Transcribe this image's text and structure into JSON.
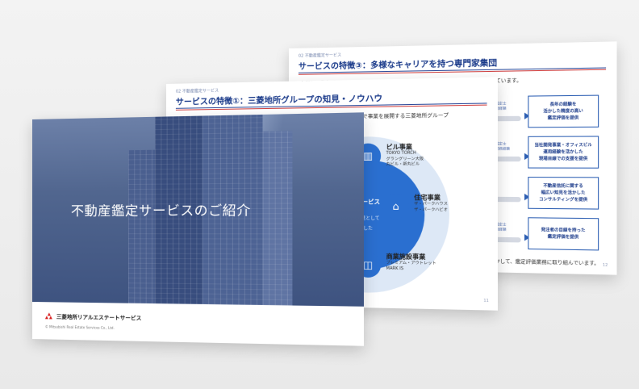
{
  "slide3": {
    "section": "02 不動産鑑定サービス",
    "title": "サービスの特徴③：多様なキャリアを持つ専門家集団",
    "intro": "多様な不動産ビジネスのキャリアを持つ、経験豊かな不動産鑑定士、専門家が在籍しています。",
    "rows": [
      {
        "small": "不動産鑑定士\n評価業務経験",
        "badge": [
          "長年の経験を",
          "活かした精度の高い",
          "鑑定評価を提供"
        ]
      },
      {
        "small": "不動産鑑定士\n不動産業務経験",
        "badge": [
          "当社開発事業・オフィスビル",
          "運用経験を活かした",
          "現場目線での支援を提供"
        ]
      },
      {
        "small": "",
        "badge": [
          "不動産信託に関する",
          "幅広い知見を活かした",
          "コンサルティングを提供"
        ]
      },
      {
        "small": "不動産鑑定士\n評価業務経験",
        "badge": [
          "発注者の目線を持った",
          "鑑定評価を提供"
        ]
      }
    ],
    "footer": "を活かして、鑑定評価業務に取り組んでいます。",
    "page": "12"
  },
  "slide2": {
    "section": "02 不動産鑑定サービス",
    "title": "サービスの特徴①：三菱地所グループの知見・ノウハウ",
    "intro": "不動産総合デベロッパーとして不動産開発から運営、管理に至るまで幅広い領域で事業を展開する三菱地所グループ",
    "intro2": "提供します。",
    "center_title": "サービス",
    "center_sub1": "知見として",
    "center_sub2": "した",
    "biz": [
      {
        "name": "ビル事業",
        "sub": [
          "TOKYO TORCH",
          "グラングリーン大阪",
          "丸ビル・新丸ビル"
        ],
        "icon": "building-icon"
      },
      {
        "name": "住宅事業",
        "sub": [
          "ザ・パークハウス",
          "ザ・パークハビオ"
        ],
        "icon": "house-icon"
      },
      {
        "name": "商業施設事業",
        "sub": [
          "プレミアム・アウトレット",
          "MARK IS"
        ],
        "icon": "shopping-bag-icon"
      }
    ],
    "page": "11"
  },
  "slide1": {
    "title": "不動産鑑定サービスのご紹介",
    "company": "三菱地所リアルエステートサービス",
    "copyright": "© Mitsubishi Real Estate Services Co., Ltd."
  },
  "colors": {
    "brand_blue": "#1a3a8a",
    "accent_blue": "#2a6fd0",
    "logo_red": "#d81e1e"
  }
}
